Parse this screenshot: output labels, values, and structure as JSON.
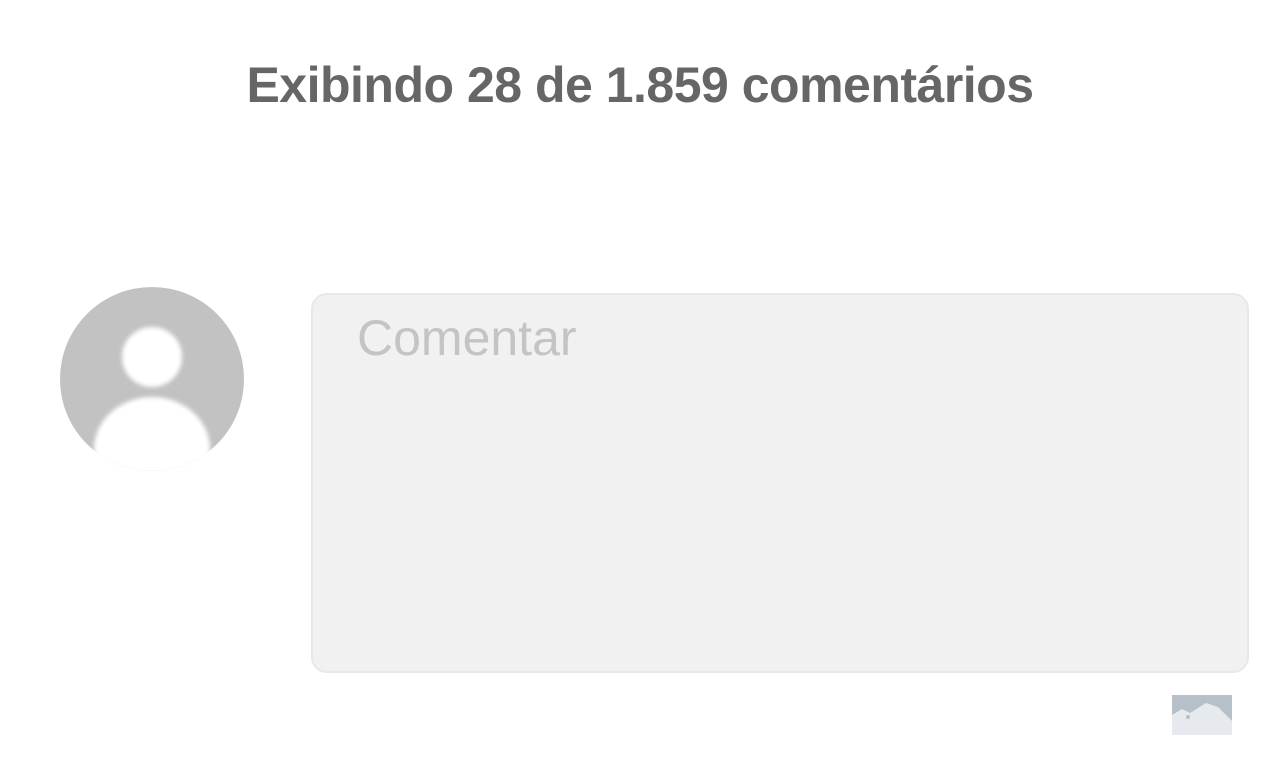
{
  "comments": {
    "heading": "Exibindo 28 de 1.859 comentários"
  },
  "composer": {
    "placeholder": "Comentar",
    "avatar_icon": "default-user-avatar-icon",
    "attach_icon": "image-icon"
  },
  "colors": {
    "heading": "#666666",
    "avatar_bg": "#c2c2c2",
    "avatar_figure": "#ffffff",
    "input_bg": "#f1f1f1",
    "input_border": "#e8e8e8",
    "placeholder": "#c4c4c4",
    "image_icon_bg": "#e6eaee",
    "image_icon_fg": "#b7c0c8"
  }
}
